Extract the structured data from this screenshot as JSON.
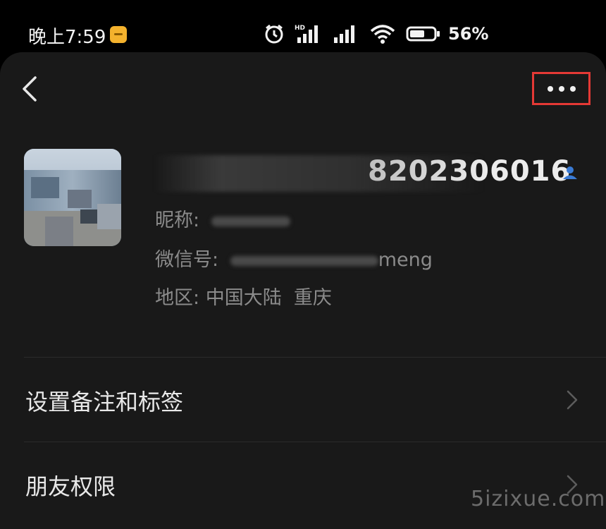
{
  "status_bar": {
    "time": "晚上7:59",
    "battery_percent": "56%",
    "icons": [
      "notification-icon",
      "alarm-icon",
      "hd-signal-icon",
      "signal-icon",
      "wifi-icon",
      "battery-icon"
    ]
  },
  "header": {
    "back_icon": "chevron-left-icon",
    "more_icon": "more-dots-icon",
    "highlight_color": "#e53935"
  },
  "profile": {
    "display_name": "8202306016",
    "nickname_label": "昵称:",
    "wechat_id_label": "微信号:",
    "wechat_id_suffix": "meng",
    "region_label": "地区:",
    "region_value": "中国大陆  重庆",
    "verified_icon": "contact-person-icon",
    "accent_color": "#3a7bd5"
  },
  "menu": {
    "items": [
      {
        "label": "设置备注和标签"
      },
      {
        "label": "朋友权限"
      }
    ]
  },
  "watermark": "5izixue.com"
}
